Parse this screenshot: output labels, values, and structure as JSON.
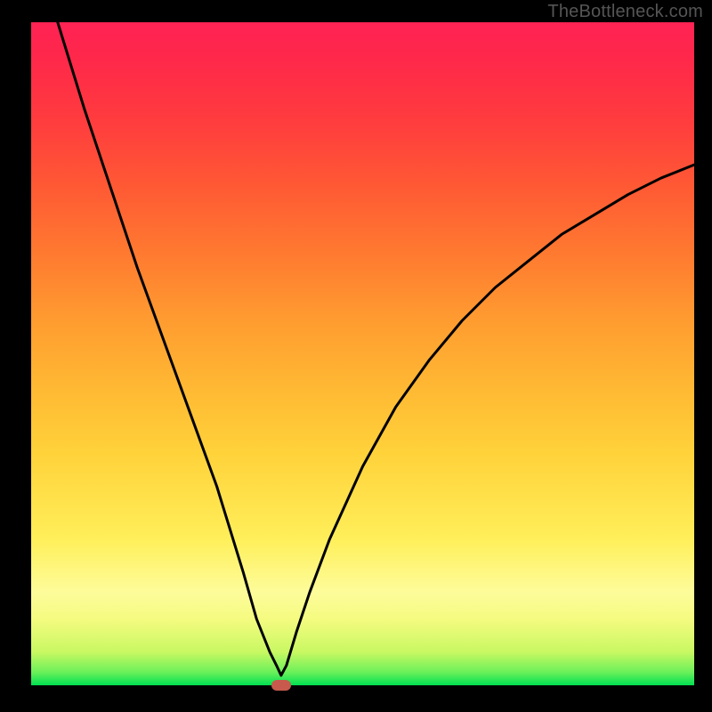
{
  "watermark": "TheBottleneck.com",
  "chart_data": {
    "type": "line",
    "title": "",
    "xlabel": "",
    "ylabel": "",
    "xlim": [
      0,
      100
    ],
    "ylim": [
      0,
      100
    ],
    "series": [
      {
        "name": "curve",
        "x": [
          4,
          8,
          12,
          16,
          20,
          24,
          28,
          32,
          34,
          36,
          37,
          37.7,
          38.5,
          40,
          42,
          45,
          50,
          55,
          60,
          65,
          70,
          75,
          80,
          85,
          90,
          95,
          100
        ],
        "values": [
          100,
          87,
          75,
          63,
          52,
          41,
          30,
          17,
          10,
          5,
          3,
          1.5,
          3,
          8,
          14,
          22,
          33,
          42,
          49,
          55,
          60,
          64,
          68,
          71,
          74,
          76.5,
          78.5
        ]
      }
    ],
    "marker": {
      "x": 37.7,
      "y": 0
    },
    "background_gradient": {
      "bottom": "#00e052",
      "top": "#ff2354"
    }
  }
}
